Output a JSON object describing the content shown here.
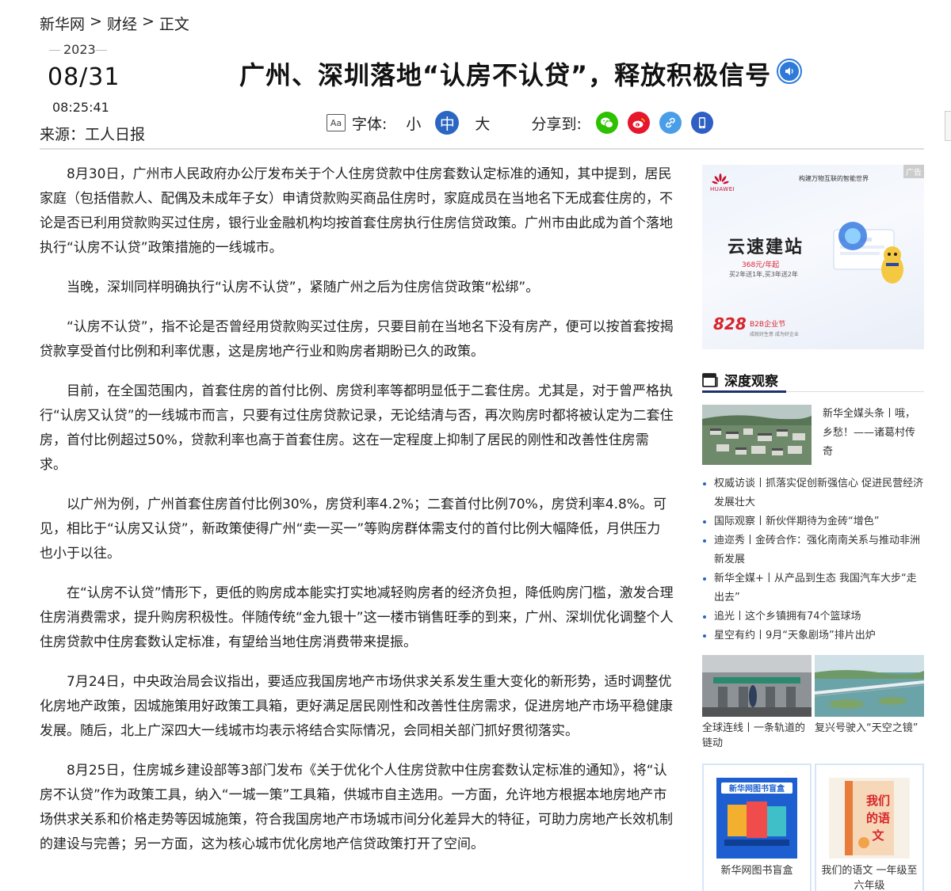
{
  "breadcrumb": {
    "site": "新华网",
    "sep1": ">",
    "section": "财经",
    "sep2": ">",
    "current": "正文"
  },
  "meta": {
    "year": "2023",
    "month_day": "08/31",
    "time": "08:25:41",
    "source": "来源：工人日报"
  },
  "title": "广州、深圳落地“认房不认贷”，释放积极信号",
  "toolbar": {
    "font_icon_text": "Aa",
    "font_label": "字体:",
    "sizes": [
      "小",
      "中",
      "大"
    ],
    "active_size": "中",
    "share_label": "分享到:",
    "share_targets": [
      "wechat-icon",
      "weibo-icon",
      "link-icon",
      "mobile-icon"
    ]
  },
  "colors": {
    "accent": "#2b67c2",
    "audio": "#2e7ad8",
    "wechat": "#2dc100",
    "weibo": "#e6162d",
    "link": "#4a9ee8",
    "mobile": "#2e5fc4",
    "section_underline": "#1f2f6d"
  },
  "article": [
    "8月30日，广州市人民政府办公厅发布关于个人住房贷款中住房套数认定标准的通知，其中提到，居民家庭（包括借款人、配偶及未成年子女）申请贷款购买商品住房时，家庭成员在当地名下无成套住房的，不论是否已利用贷款购买过住房，银行业金融机构均按首套住房执行住房信贷政策。广州市由此成为首个落地执行“认房不认贷”政策措施的一线城市。",
    "当晚，深圳同样明确执行“认房不认贷”，紧随广州之后为住房信贷政策“松绑”。",
    "“认房不认贷”，指不论是否曾经用贷款购买过住房，只要目前在当地名下没有房产，便可以按首套按揭贷款享受首付比例和利率优惠，这是房地产行业和购房者期盼已久的政策。",
    "目前，在全国范围内，首套住房的首付比例、房贷利率等都明显低于二套住房。尤其是，对于曾严格执行“认房又认贷”的一线城市而言，只要有过住房贷款记录，无论结清与否，再次购房时都将被认定为二套住房，首付比例超过50%，贷款利率也高于首套住房。这在一定程度上抑制了居民的刚性和改善性住房需求。",
    "以广州为例，广州首套住房首付比例30%，房贷利率4.2%；二套首付比例70%，房贷利率4.8%。可见，相比于“认房又认贷”，新政策使得广州“卖一买一”等购房群体需支付的首付比例大幅降低，月供压力也小于以往。",
    "在“认房不认贷”情形下，更低的购房成本能实打实地减轻购房者的经济负担，降低购房门槛，激发合理住房消费需求，提升购房积极性。伴随传统“金九银十”这一楼市销售旺季的到来，广州、深圳优化调整个人住房贷款中住房套数认定标准，有望给当地住房消费带来提振。",
    "7月24日，中央政治局会议指出，要适应我国房地产市场供求关系发生重大变化的新形势，适时调整优化房地产政策，因城施策用好政策工具箱，更好满足居民刚性和改善性住房需求，促进房地产市场平稳健康发展。随后，北上广深四大一线城市均表示将结合实际情况，会同相关部门抓好贯彻落实。",
    "8月25日，住房城乡建设部等3部门发布《关于优化个人住房贷款中住房套数认定标准的通知》，将“认房不认贷”作为政策工具，纳入“一城一策”工具箱，供城市自主选用。一方面，允许地方根据本地房地产市场供求关系和价格走势等因城施策，符合我国房地产市场城市间分化差异大的特征，可助力房地产长效机制的建设与完善；另一方面，这为核心城市优化房地产信贷政策打开了空间。"
  ],
  "sidebar": {
    "ad": {
      "tag": "广告",
      "brand": "HUAWEI",
      "slogan": "构建万物互联的智能世界",
      "headline": "云速建站",
      "price": "368元/年起",
      "offer": "买2年送1年,买3年送2年",
      "event_num": "828",
      "event_name": "B2B企业节",
      "event_sub": "成就好生意 成为好企业"
    },
    "section_title": "深度观察",
    "feature_text": "新华全媒头条丨哦，乡愁！——诸葛村传奇",
    "news": [
      "权威访谈丨抓落实促创新强信心 促进民营经济发展壮大",
      "国际观察丨新伙伴期待为金砖“增色”",
      "迪迩秀丨金砖合作：强化南南关系与推动非洲新发展",
      "新华全媒+丨从产品到生态 我国汽车大步“走出去”",
      "追光丨这个乡镇拥有74个篮球场",
      "星空有约丨9月“天象剧场”排片出炉"
    ],
    "photos": [
      {
        "caption": "全球连线丨一条轨道的链动"
      },
      {
        "caption": "复兴号驶入“天空之镜”"
      }
    ],
    "books": [
      {
        "cover_title": "新华网图书盲盒",
        "caption": "新华网图书盲盒"
      },
      {
        "cover_title": "我们的语文",
        "caption": "我们的语文 一年级至六年级"
      }
    ]
  }
}
